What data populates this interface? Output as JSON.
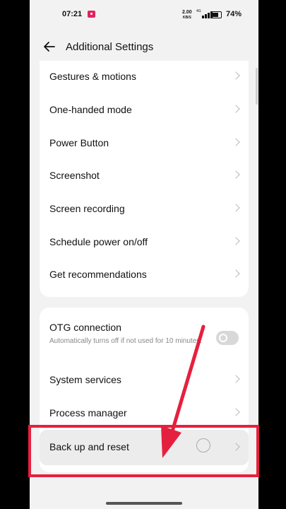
{
  "status_bar": {
    "time": "07:21",
    "speed_value": "2.00",
    "speed_unit": "KB/S",
    "network": "4G",
    "battery": "74%"
  },
  "header": {
    "back_icon": "arrow-left-icon",
    "title": "Additional Settings"
  },
  "settings_group_1": [
    {
      "label": "Gestures & motions"
    },
    {
      "label": "One-handed mode"
    },
    {
      "label": "Power Button"
    },
    {
      "label": "Screenshot"
    },
    {
      "label": "Screen recording"
    },
    {
      "label": "Schedule power on/off"
    },
    {
      "label": "Get recommendations"
    }
  ],
  "settings_group_2": {
    "otg": {
      "label": "OTG connection",
      "description": "Automatically turns off if not used for 10 minutes.",
      "toggle_on": false
    },
    "system_services": {
      "label": "System services"
    },
    "process_manager": {
      "label": "Process manager"
    },
    "backup_reset": {
      "label": "Back up and reset"
    }
  },
  "annotation": {
    "color": "#e5203e"
  },
  "colors": {
    "background": "#f2f2f2",
    "card": "#ffffff"
  }
}
